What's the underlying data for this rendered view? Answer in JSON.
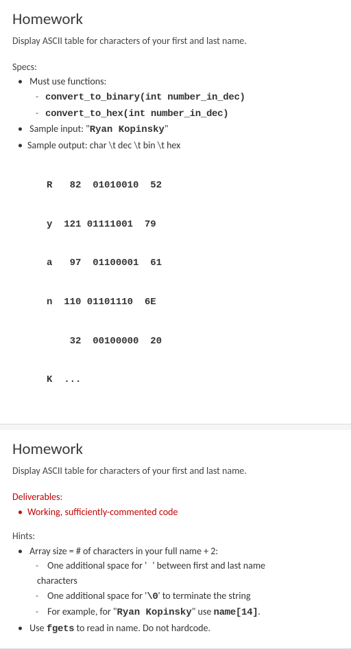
{
  "section1": {
    "title": "Homework",
    "subtitle": "Display ASCII  table for characters of your first and last name.",
    "specs_label": "Specs:",
    "bullets": {
      "b1": "Must use functions:",
      "f1": "convert_to_binary(int number_in_dec)",
      "f2": "convert_to_hex(int number_in_dec)",
      "b2_pre": "Sample input: \"",
      "b2_code": "Ryan Kopinsky",
      "b2_post": "\"",
      "b3": "Sample output: char \\t dec \\t bin \\t hex"
    },
    "table_rows": [
      "R   82  01010010  52",
      "y  121 01111001  79",
      "a   97  01100001  61",
      "n  110 01101110  6E",
      "    32  00100000  20",
      "K  ..."
    ]
  },
  "section2": {
    "title": "Homework",
    "subtitle": "Display ASCII table for characters of your first and last name.",
    "deliverables_label": "Deliverables:",
    "deliverable1": "Working, sufficiently-commented code",
    "hints_label": "Hints:",
    "h1": "Array size = # of characters in your full name + 2:",
    "h1a_pre": "One additional space for '",
    "h1a_mid": " ",
    "h1a_post": "' between first and last name",
    "h1a_line2": "characters",
    "h1b_pre": "One additional space for '",
    "h1b_code": "\\0",
    "h1b_post": "' to terminate the string",
    "h1c_pre": "For example, for \"",
    "h1c_code1": "Ryan Kopinsky",
    "h1c_mid": "\" use ",
    "h1c_code2": "name[14]",
    "h1c_post": ".",
    "h2_pre": "Use ",
    "h2_code": "fgets",
    "h2_post": " to read in name. Do not hardcode."
  }
}
